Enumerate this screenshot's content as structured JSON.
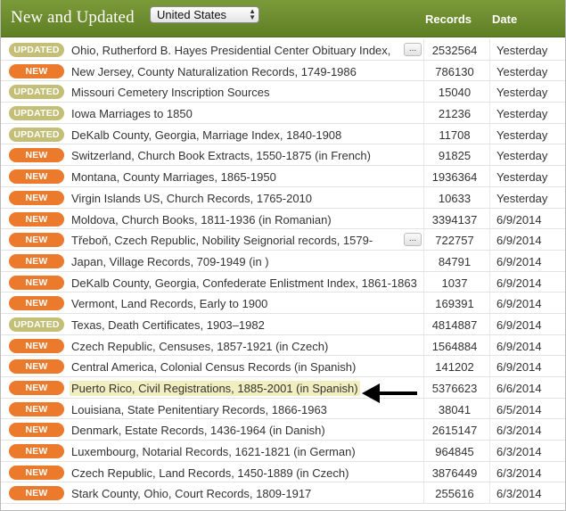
{
  "header": {
    "title": "New and Updated",
    "country_selected": "United States",
    "col_records": "Records",
    "col_date": "Date",
    "header_color": "#6b8a2e"
  },
  "badge_colors": {
    "NEW": "#ec7a2d",
    "UPDATED": "#c3bf77"
  },
  "rows": [
    {
      "badge": "UPDATED",
      "name": "Ohio, Rutherford B. Hayes Presidential Center Obituary Index,",
      "more": "...",
      "records": "2532564",
      "date": "Yesterday"
    },
    {
      "badge": "NEW",
      "name": "New Jersey, County Naturalization Records, 1749-1986",
      "records": "786130",
      "date": "Yesterday"
    },
    {
      "badge": "UPDATED",
      "name": "Missouri Cemetery Inscription Sources",
      "records": "15040",
      "date": "Yesterday"
    },
    {
      "badge": "UPDATED",
      "name": "Iowa Marriages to 1850",
      "records": "21236",
      "date": "Yesterday"
    },
    {
      "badge": "UPDATED",
      "name": "DeKalb County, Georgia, Marriage Index, 1840-1908",
      "records": "11708",
      "date": "Yesterday"
    },
    {
      "badge": "NEW",
      "name": "Switzerland, Church Book Extracts, 1550-1875 (in French)",
      "records": "91825",
      "date": "Yesterday"
    },
    {
      "badge": "NEW",
      "name": "Montana, County Marriages, 1865-1950",
      "records": "1936364",
      "date": "Yesterday"
    },
    {
      "badge": "NEW",
      "name": "Virgin Islands US, Church Records, 1765-2010",
      "records": "10633",
      "date": "Yesterday"
    },
    {
      "badge": "NEW",
      "name": "Moldova, Church Books, 1811-1936 (in Romanian)",
      "records": "3394137",
      "date": "6/9/2014"
    },
    {
      "badge": "NEW",
      "name": "Třeboň, Czech Republic, Nobility Seignorial records, 1579-",
      "more": "...",
      "records": "722757",
      "date": "6/9/2014"
    },
    {
      "badge": "NEW",
      "name": "Japan, Village Records, 709-1949 (in )",
      "records": "84791",
      "date": "6/9/2014"
    },
    {
      "badge": "NEW",
      "name": "DeKalb County, Georgia, Confederate Enlistment Index, 1861-1863",
      "records": "1037",
      "date": "6/9/2014"
    },
    {
      "badge": "NEW",
      "name": "Vermont, Land Records, Early to 1900",
      "records": "169391",
      "date": "6/9/2014"
    },
    {
      "badge": "UPDATED",
      "name": "Texas, Death Certificates, 1903–1982",
      "records": "4814887",
      "date": "6/9/2014"
    },
    {
      "badge": "NEW",
      "name": "Czech Republic, Censuses, 1857-1921 (in Czech)",
      "records": "1564884",
      "date": "6/9/2014"
    },
    {
      "badge": "NEW",
      "name": "Central America, Colonial Census Records (in Spanish)",
      "records": "141202",
      "date": "6/9/2014"
    },
    {
      "badge": "NEW",
      "name": "Puerto Rico, Civil Registrations, 1885-2001 (in Spanish)",
      "records": "5376623",
      "date": "6/6/2014",
      "highlight": true
    },
    {
      "badge": "NEW",
      "name": "Louisiana, State Penitentiary Records, 1866-1963",
      "records": "38041",
      "date": "6/5/2014"
    },
    {
      "badge": "NEW",
      "name": "Denmark, Estate Records, 1436-1964 (in Danish)",
      "records": "2615147",
      "date": "6/3/2014"
    },
    {
      "badge": "NEW",
      "name": "Luxembourg, Notarial Records, 1621-1821 (in German)",
      "records": "964845",
      "date": "6/3/2014"
    },
    {
      "badge": "NEW",
      "name": "Czech Republic, Land Records, 1450-1889 (in Czech)",
      "records": "3876449",
      "date": "6/3/2014"
    },
    {
      "badge": "NEW",
      "name": "Stark County, Ohio, Court Records, 1809-1917",
      "records": "255616",
      "date": "6/3/2014"
    }
  ]
}
